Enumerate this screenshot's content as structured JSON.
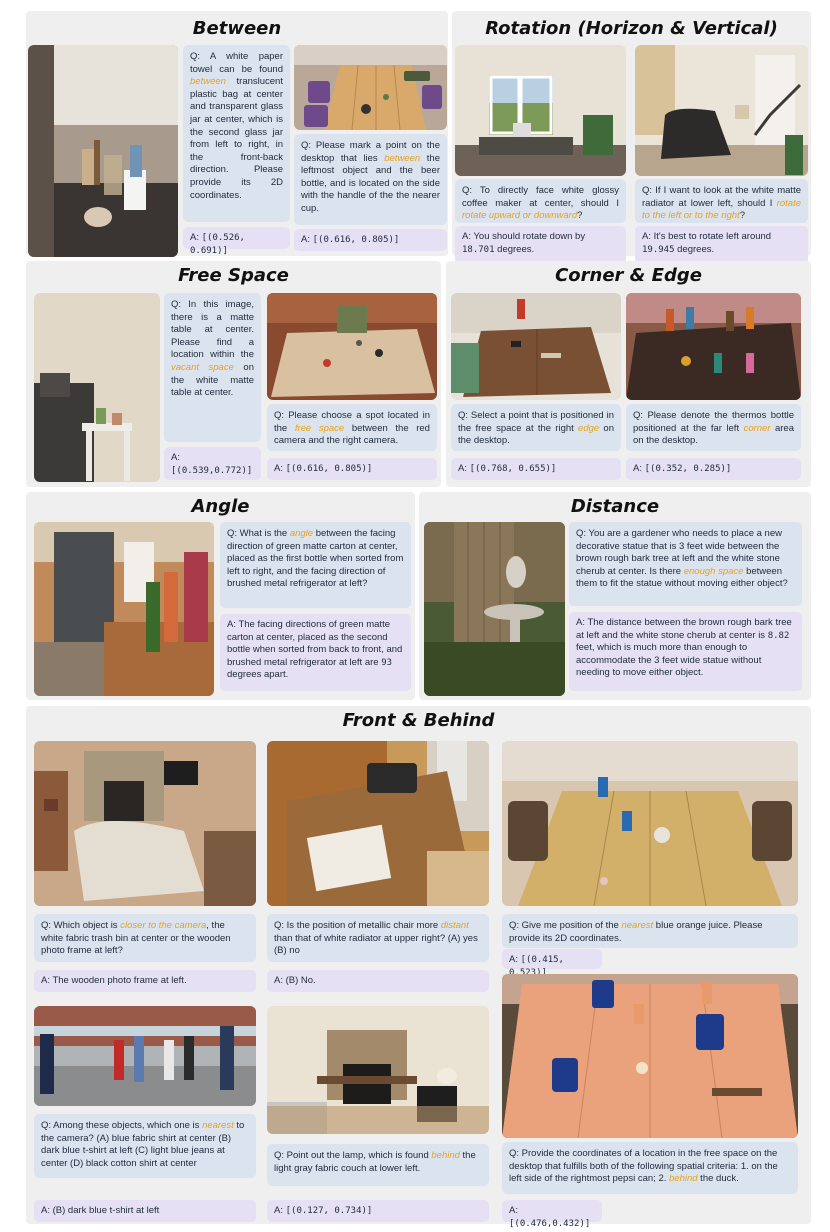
{
  "colors": {
    "highlight": "#e8a21a",
    "question_bg": "#dbe3ef",
    "answer_bg": "#e6e0f5",
    "panel_bg": "#efefef"
  },
  "sections": {
    "between": {
      "title": "Between",
      "q1": {
        "pre": "Q: A white paper towel can be found ",
        "hl": "between",
        "post": " translucent plastic bag at center and transparent glass jar at center, which is the second glass jar from left to right, in the front-back direction. Please provide its 2D coordinates."
      },
      "a1": {
        "pre": "A: ",
        "value": "[(0.526, 0.691)]"
      },
      "q2": {
        "pre": "Q: Please mark a point on the desktop that lies ",
        "hl": "between",
        "post": " the leftmost object and the beer bottle, and is located on the side with the handle of the the nearer cup."
      },
      "a2": {
        "pre": "A: ",
        "value": "[(0.616, 0.805)]"
      }
    },
    "rotation": {
      "title": "Rotation (Horizon & Vertical)",
      "q1": {
        "pre": "Q: To directly face white glossy coffee maker at center, should I ",
        "hl": "rotate upward or downward",
        "post": "?"
      },
      "a1": {
        "pre": "A: You should rotate down by ",
        "value": "18.701",
        "post": " degrees."
      },
      "q2": {
        "pre": "Q: If I want to look at the white matte radiator at lower left, should I ",
        "hl": "rotate to the left or to the right",
        "post": "?"
      },
      "a2": {
        "pre": "A: It's best to rotate left around ",
        "value": "19.945",
        "post": " degrees."
      }
    },
    "free_space": {
      "title": "Free Space",
      "q1": {
        "pre": "Q: In this image, there is a matte table at center. Please find a location within the ",
        "hl": "vacant space",
        "post": " on the white matte table at center."
      },
      "a1": {
        "pre": "A: ",
        "value": "[(0.539,0.772)]"
      },
      "q2": {
        "pre": "Q: Please choose a spot located in the ",
        "hl": "free space",
        "post": " between the red camera and the right camera."
      },
      "a2": {
        "pre": "A: ",
        "value": "[(0.616, 0.805)]"
      }
    },
    "corner_edge": {
      "title": "Corner & Edge",
      "q1": {
        "pre": "Q: Select a point that is positioned in the free space at the right ",
        "hl": "edge",
        "post": " on the desktop."
      },
      "a1": {
        "pre": "A: ",
        "value": "[(0.768, 0.655)]"
      },
      "q2": {
        "pre": "Q: Please denote the thermos bottle positioned at the far left ",
        "hl": "corner",
        "post": " area on the desktop."
      },
      "a2": {
        "pre": "A: ",
        "value": "[(0.352, 0.285)]"
      }
    },
    "angle": {
      "title": "Angle",
      "q1": {
        "pre": "Q: What is the ",
        "hl": "angle",
        "post": " between the facing direction of green matte carton at center, placed as the first bottle when sorted from left to right, and the facing direction of brushed metal refrigerator at left?"
      },
      "a1": {
        "pre": "A: The facing directions of green matte carton at center, placed as the second bottle when sorted from back to front, and brushed metal refrigerator at left are ",
        "value": "93",
        "post": " degrees apart."
      }
    },
    "distance": {
      "title": "Distance",
      "q1": {
        "pre": "Q: You are a gardener who needs to place a new decorative statue that is 3 feet wide between the brown rough bark tree at left and the white stone cherub at center. Is there ",
        "hl": "enough space",
        "post": " between them to fit the statue without moving either object?"
      },
      "a1": {
        "pre": "A: The distance between the brown rough bark tree at left and the white stone cherub at center is ",
        "value": "8.82",
        "post": " feet, which is much more than enough to accommodate the 3 feet wide statue without needing to move either object."
      }
    },
    "front_behind": {
      "title": "Front & Behind",
      "q1": {
        "pre": "Q: Which object is ",
        "hl": "closer to the camera",
        "post": ", the white fabric trash bin at center or the wooden photo frame at left?"
      },
      "a1": {
        "pre": "A: The wooden photo frame at left.",
        "value": ""
      },
      "q2": {
        "pre": "Q: Is the position of metallic chair more ",
        "hl": "distant",
        "post": " than that of white radiator at upper right? (A) yes (B) no"
      },
      "a2": {
        "pre": "A: (B) No.",
        "value": ""
      },
      "q3": {
        "pre": "Q: Give me position of the ",
        "hl": "nearest",
        "post": " blue orange juice. Please provide its 2D coordinates."
      },
      "a3": {
        "pre": "A: ",
        "value": "[(0.415, 0.523)]"
      },
      "q4": {
        "pre": "Q: Among these objects, which one is ",
        "hl": "nearest",
        "post": " to the camera? (A) blue fabric shirt at center (B) dark blue t-shirt at left (C) light blue jeans at center (D) black cotton shirt at center"
      },
      "a4": {
        "pre": "A: (B) dark blue t-shirt at left",
        "value": ""
      },
      "q5": {
        "pre": "Q: Point out the lamp, which is found ",
        "hl": "behind",
        "post": " the light gray fabric couch at lower left."
      },
      "a5": {
        "pre": "A: ",
        "value": "[(0.127, 0.734)]"
      },
      "q6": {
        "pre": "Q: Provide the coordinates of a location in the free space on the desktop that fulfills both of the following spatial criteria: 1. on the left side of the rightmost pepsi can; 2. ",
        "hl": "behind",
        "post": " the duck."
      },
      "a6": {
        "pre": "A: ",
        "value": "[(0.476,0.432)]"
      }
    }
  }
}
